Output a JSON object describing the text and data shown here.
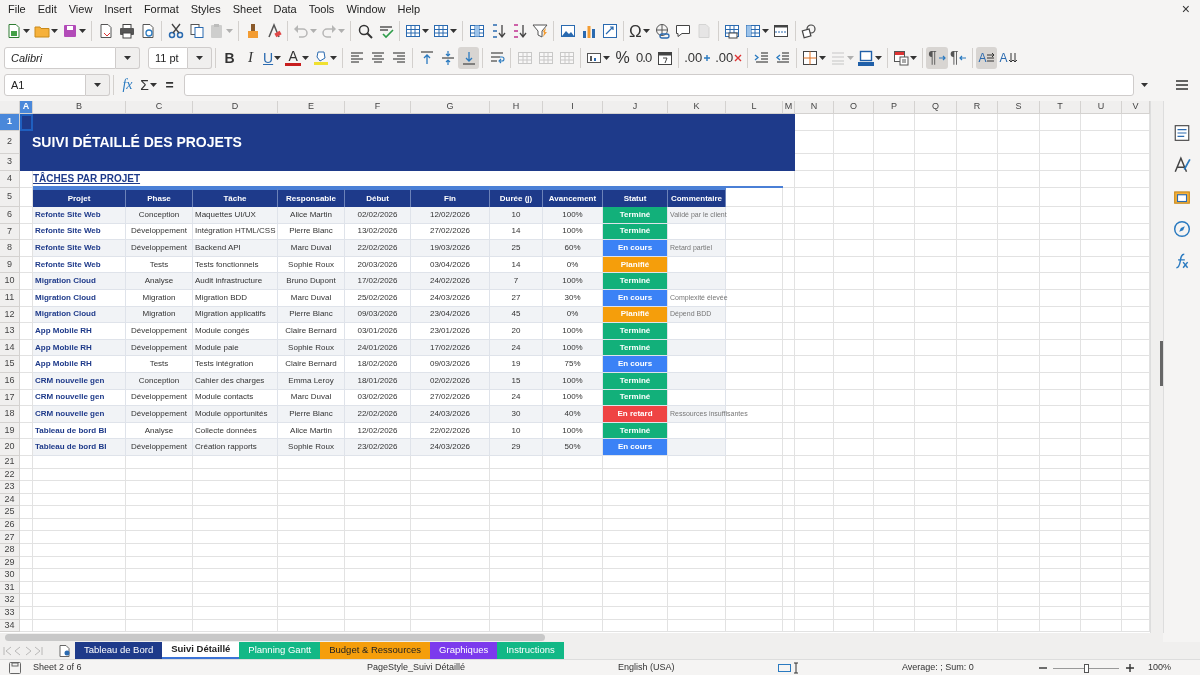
{
  "menu": [
    "File",
    "Edit",
    "View",
    "Insert",
    "Format",
    "Styles",
    "Sheet",
    "Data",
    "Tools",
    "Window",
    "Help"
  ],
  "close_document": "×",
  "standard_toolbar": [
    [
      {
        "kind": "new",
        "dropdown": true,
        "disabled": false
      },
      {
        "kind": "open",
        "dropdown": true,
        "disabled": false
      },
      {
        "kind": "save",
        "dropdown": true,
        "disabled": false
      }
    ],
    [
      {
        "kind": "pdf",
        "dropdown": false,
        "disabled": false
      },
      {
        "kind": "print",
        "dropdown": false,
        "disabled": false
      },
      {
        "kind": "preview",
        "dropdown": false,
        "disabled": false
      }
    ],
    [
      {
        "kind": "cut",
        "dropdown": false,
        "disabled": false
      },
      {
        "kind": "copy",
        "dropdown": false,
        "disabled": false
      },
      {
        "kind": "paste",
        "dropdown": true,
        "disabled": true
      }
    ],
    [
      {
        "kind": "clone",
        "dropdown": false,
        "disabled": false
      },
      {
        "kind": "clear",
        "dropdown": false,
        "disabled": false
      }
    ],
    [
      {
        "kind": "undo",
        "dropdown": true,
        "disabled": true
      },
      {
        "kind": "redo",
        "dropdown": true,
        "disabled": true
      }
    ],
    [
      {
        "kind": "find",
        "dropdown": false,
        "disabled": false
      },
      {
        "kind": "spelling",
        "dropdown": false,
        "disabled": false
      }
    ],
    [
      {
        "kind": "rows",
        "dropdown": true,
        "disabled": false
      },
      {
        "kind": "columns",
        "dropdown": true,
        "disabled": false
      }
    ],
    [
      {
        "kind": "sort",
        "dropdown": false,
        "disabled": false
      },
      {
        "kind": "ascending",
        "dropdown": false,
        "disabled": false
      },
      {
        "kind": "descending",
        "dropdown": false,
        "disabled": false
      },
      {
        "kind": "filter",
        "dropdown": false,
        "disabled": false
      }
    ],
    [
      {
        "kind": "image",
        "dropdown": false,
        "disabled": false
      },
      {
        "kind": "chart",
        "dropdown": false,
        "disabled": false
      },
      {
        "kind": "pivot",
        "dropdown": false,
        "disabled": false
      }
    ],
    [
      {
        "kind": "special",
        "label": "Ω",
        "dropdown": true,
        "disabled": false
      },
      {
        "kind": "hyperlink",
        "dropdown": false,
        "disabled": false
      },
      {
        "kind": "comment",
        "dropdown": false,
        "disabled": false
      },
      {
        "kind": "headers",
        "dropdown": false,
        "disabled": true
      }
    ],
    [
      {
        "kind": "printarea",
        "dropdown": false,
        "disabled": false
      },
      {
        "kind": "freeze",
        "dropdown": true,
        "disabled": false
      },
      {
        "kind": "split",
        "dropdown": false,
        "disabled": false
      }
    ],
    [
      {
        "kind": "shapes",
        "dropdown": false,
        "disabled": false
      }
    ]
  ],
  "formatting_toolbar": {
    "font_name": "Calibri",
    "font_size": "11 pt",
    "groups": [
      [
        {
          "kind": "bold",
          "label": "B",
          "dropdown": false,
          "disabled": false,
          "pressed": false
        },
        {
          "kind": "italic",
          "label": "I",
          "dropdown": false,
          "disabled": false,
          "pressed": false
        },
        {
          "kind": "underline",
          "label": "U",
          "dropdown": true,
          "disabled": false,
          "pressed": false
        },
        {
          "kind": "fontcolor",
          "label": "A",
          "dropdown": true,
          "disabled": false,
          "pressed": false
        },
        {
          "kind": "highlight",
          "dropdown": true,
          "disabled": false,
          "pressed": false
        }
      ],
      [
        {
          "kind": "left",
          "dropdown": false,
          "disabled": false,
          "pressed": false
        },
        {
          "kind": "center",
          "dropdown": false,
          "disabled": false,
          "pressed": false
        },
        {
          "kind": "right",
          "dropdown": false,
          "disabled": false,
          "pressed": false
        }
      ],
      [
        {
          "kind": "top",
          "dropdown": false,
          "disabled": false,
          "pressed": false
        },
        {
          "kind": "middle",
          "dropdown": false,
          "disabled": false,
          "pressed": false
        },
        {
          "kind": "bottom",
          "dropdown": false,
          "disabled": false,
          "pressed": true
        }
      ],
      [
        {
          "kind": "wrap",
          "dropdown": false,
          "disabled": false,
          "pressed": false
        }
      ],
      [
        {
          "kind": "mergecenter",
          "dropdown": false,
          "disabled": true,
          "pressed": false
        },
        {
          "kind": "merge",
          "dropdown": false,
          "disabled": true,
          "pressed": false
        },
        {
          "kind": "unmerge",
          "dropdown": false,
          "disabled": true,
          "pressed": false
        }
      ],
      [
        {
          "kind": "numberformat",
          "dropdown": true,
          "disabled": false,
          "pressed": false
        },
        {
          "kind": "percent",
          "label": "%",
          "dropdown": false,
          "disabled": false,
          "pressed": false
        },
        {
          "kind": "standard",
          "label": "0.0",
          "dropdown": false,
          "disabled": false,
          "pressed": false
        },
        {
          "kind": "date",
          "dropdown": false,
          "disabled": false,
          "pressed": false
        }
      ],
      [
        {
          "kind": "adddecimal",
          "label": ".00",
          "dropdown": false,
          "disabled": false,
          "pressed": false
        },
        {
          "kind": "deldecimal",
          "label": ".00",
          "dropdown": false,
          "disabled": false,
          "pressed": false
        }
      ],
      [
        {
          "kind": "indent",
          "dropdown": false,
          "disabled": false,
          "pressed": false
        },
        {
          "kind": "outdent",
          "dropdown": false,
          "disabled": false,
          "pressed": false
        }
      ],
      [
        {
          "kind": "borders",
          "dropdown": true,
          "disabled": false,
          "pressed": false
        },
        {
          "kind": "borderstyle",
          "dropdown": true,
          "disabled": true,
          "pressed": false
        },
        {
          "kind": "bordercolor",
          "dropdown": true,
          "disabled": false,
          "pressed": false
        }
      ],
      [
        {
          "kind": "conditional",
          "dropdown": true,
          "disabled": false,
          "pressed": false
        }
      ],
      [
        {
          "kind": "ltr",
          "label": "¶",
          "dropdown": false,
          "disabled": false,
          "pressed": true
        },
        {
          "kind": "rtl",
          "label": "¶",
          "dropdown": false,
          "disabled": false,
          "pressed": false
        }
      ],
      [
        {
          "kind": "horizontal",
          "label": "A",
          "dropdown": false,
          "disabled": false,
          "pressed": true
        },
        {
          "kind": "vertical",
          "label": "A",
          "dropdown": false,
          "disabled": false,
          "pressed": false
        }
      ]
    ]
  },
  "formula_bar": {
    "cell_reference": "A1",
    "function_wizard": "fx",
    "sum": "Σ",
    "equals": "="
  },
  "columns": [
    {
      "label": "A",
      "selected": true
    },
    {
      "label": "B",
      "selected": false
    },
    {
      "label": "C",
      "selected": false
    },
    {
      "label": "D",
      "selected": false
    },
    {
      "label": "E",
      "selected": false
    },
    {
      "label": "F",
      "selected": false
    },
    {
      "label": "G",
      "selected": false
    },
    {
      "label": "H",
      "selected": false
    },
    {
      "label": "I",
      "selected": false
    },
    {
      "label": "J",
      "selected": false
    },
    {
      "label": "K",
      "selected": false
    },
    {
      "label": "L",
      "selected": false
    },
    {
      "label": "M",
      "selected": false
    },
    {
      "label": "N",
      "selected": false
    },
    {
      "label": "O",
      "selected": false
    },
    {
      "label": "P",
      "selected": false
    },
    {
      "label": "Q",
      "selected": false
    },
    {
      "label": "R",
      "selected": false
    },
    {
      "label": "S",
      "selected": false
    },
    {
      "label": "T",
      "selected": false
    },
    {
      "label": "U",
      "selected": false
    },
    {
      "label": "V",
      "selected": false
    }
  ],
  "rows": [
    {
      "label": "1",
      "selected": true
    },
    {
      "label": "2",
      "selected": false
    },
    {
      "label": "3",
      "selected": false
    },
    {
      "label": "4",
      "selected": false
    },
    {
      "label": "5",
      "selected": false
    },
    {
      "label": "6",
      "selected": false
    },
    {
      "label": "7",
      "selected": false
    },
    {
      "label": "8",
      "selected": false
    },
    {
      "label": "9",
      "selected": false
    },
    {
      "label": "10",
      "selected": false
    },
    {
      "label": "11",
      "selected": false
    },
    {
      "label": "12",
      "selected": false
    },
    {
      "label": "13",
      "selected": false
    },
    {
      "label": "14",
      "selected": false
    },
    {
      "label": "15",
      "selected": false
    },
    {
      "label": "16",
      "selected": false
    },
    {
      "label": "17",
      "selected": false
    },
    {
      "label": "18",
      "selected": false
    },
    {
      "label": "19",
      "selected": false
    },
    {
      "label": "20",
      "selected": false
    },
    {
      "label": "21",
      "selected": false
    },
    {
      "label": "22",
      "selected": false
    },
    {
      "label": "23",
      "selected": false
    },
    {
      "label": "24",
      "selected": false
    },
    {
      "label": "25",
      "selected": false
    },
    {
      "label": "26",
      "selected": false
    },
    {
      "label": "27",
      "selected": false
    },
    {
      "label": "28",
      "selected": false
    },
    {
      "label": "29",
      "selected": false
    },
    {
      "label": "30",
      "selected": false
    },
    {
      "label": "31",
      "selected": false
    },
    {
      "label": "32",
      "selected": false
    },
    {
      "label": "33",
      "selected": false
    },
    {
      "label": "34",
      "selected": false
    }
  ],
  "sheet": {
    "title": "SUIVI DÉTAILLÉ DES PROJETS",
    "subtitle": "TÂCHES PAR PROJET",
    "table": {
      "columns": [
        "Projet",
        "Phase",
        "Tâche",
        "Responsable",
        "Début",
        "Fin",
        "Durée (j)",
        "Avancement",
        "Statut",
        "Commentaire"
      ],
      "rows": [
        {
          "cells": [
            "Refonte Site Web",
            "Conception",
            "Maquettes UI/UX",
            "Alice Martin",
            "02/02/2026",
            "12/02/2026",
            "10",
            "100%",
            "Terminé",
            "Validé par le client"
          ],
          "color": "#12b07a"
        },
        {
          "cells": [
            "Refonte Site Web",
            "Développement",
            "Intégration HTML/CSS",
            "Pierre Blanc",
            "13/02/2026",
            "27/02/2026",
            "14",
            "100%",
            "Terminé"
          ],
          "color": "#12b07a"
        },
        {
          "cells": [
            "Refonte Site Web",
            "Développement",
            "Backend API",
            "Marc Duval",
            "22/02/2026",
            "19/03/2026",
            "25",
            "60%",
            "En cours",
            "Retard partiel"
          ],
          "color": "#3b82f6"
        },
        {
          "cells": [
            "Refonte Site Web",
            "Tests",
            "Tests fonctionnels",
            "Sophie Roux",
            "20/03/2026",
            "03/04/2026",
            "14",
            "0%",
            "Planifié"
          ],
          "color": "#f59e0b"
        },
        {
          "cells": [
            "Migration Cloud",
            "Analyse",
            "Audit infrastructure",
            "Bruno Dupont",
            "17/02/2026",
            "24/02/2026",
            "7",
            "100%",
            "Terminé"
          ],
          "color": "#12b07a"
        },
        {
          "cells": [
            "Migration Cloud",
            "Migration",
            "Migration BDD",
            "Marc Duval",
            "25/02/2026",
            "24/03/2026",
            "27",
            "30%",
            "En cours",
            "Complexité élevée"
          ],
          "color": "#3b82f6"
        },
        {
          "cells": [
            "Migration Cloud",
            "Migration",
            "Migration applicatifs",
            "Pierre Blanc",
            "09/03/2026",
            "23/04/2026",
            "45",
            "0%",
            "Planifié",
            "Dépend BDD"
          ],
          "color": "#f59e0b"
        },
        {
          "cells": [
            "App Mobile RH",
            "Développement",
            "Module congés",
            "Claire Bernard",
            "03/01/2026",
            "23/01/2026",
            "20",
            "100%",
            "Terminé"
          ],
          "color": "#12b07a"
        },
        {
          "cells": [
            "App Mobile RH",
            "Développement",
            "Module paie",
            "Sophie Roux",
            "24/01/2026",
            "17/02/2026",
            "24",
            "100%",
            "Terminé"
          ],
          "color": "#12b07a"
        },
        {
          "cells": [
            "App Mobile RH",
            "Tests",
            "Tests intégration",
            "Claire Bernard",
            "18/02/2026",
            "09/03/2026",
            "19",
            "75%",
            "En cours"
          ],
          "color": "#3b82f6"
        },
        {
          "cells": [
            "CRM nouvelle gen",
            "Conception",
            "Cahier des charges",
            "Emma Leroy",
            "18/01/2026",
            "02/02/2026",
            "15",
            "100%",
            "Terminé"
          ],
          "color": "#12b07a"
        },
        {
          "cells": [
            "CRM nouvelle gen",
            "Développement",
            "Module contacts",
            "Marc Duval",
            "03/02/2026",
            "27/02/2026",
            "24",
            "100%",
            "Terminé"
          ],
          "color": "#12b07a"
        },
        {
          "cells": [
            "CRM nouvelle gen",
            "Développement",
            "Module opportunités",
            "Pierre Blanc",
            "22/02/2026",
            "24/03/2026",
            "30",
            "40%",
            "En retard",
            "Ressources insuffisantes"
          ],
          "color": "#ef4444"
        },
        {
          "cells": [
            "Tableau de bord BI",
            "Analyse",
            "Collecte données",
            "Alice Martin",
            "12/02/2026",
            "22/02/2026",
            "10",
            "100%",
            "Terminé"
          ],
          "color": "#12b07a"
        },
        {
          "cells": [
            "Tableau de bord BI",
            "Développement",
            "Création rapports",
            "Sophie Roux",
            "23/02/2026",
            "24/03/2026",
            "29",
            "50%",
            "En cours"
          ],
          "color": "#3b82f6"
        }
      ]
    }
  },
  "sheet_tabs": [
    {
      "label": "Tableau de Bord",
      "color": "#1e3a8a",
      "selected": false
    },
    {
      "label": "Suivi Détaillé",
      "color": "#3b73d6",
      "selected": true
    },
    {
      "label": "Planning Gantt",
      "color": "#12b886",
      "selected": false
    },
    {
      "label": "Budget & Ressources",
      "color": "#f59e0b",
      "selected": false
    },
    {
      "label": "Graphiques",
      "color": "#7c3aed",
      "selected": false
    },
    {
      "label": "Instructions",
      "color": "#12b886",
      "selected": false
    }
  ],
  "status_bar": {
    "sheet": "Sheet 2 of 6",
    "page_style": "PageStyle_Suivi Détaillé",
    "language": "English (USA)",
    "summary": "Average: ; Sum: 0",
    "zoom": "100%",
    "zoom_slider": {
      "level": 0.5
    }
  }
}
